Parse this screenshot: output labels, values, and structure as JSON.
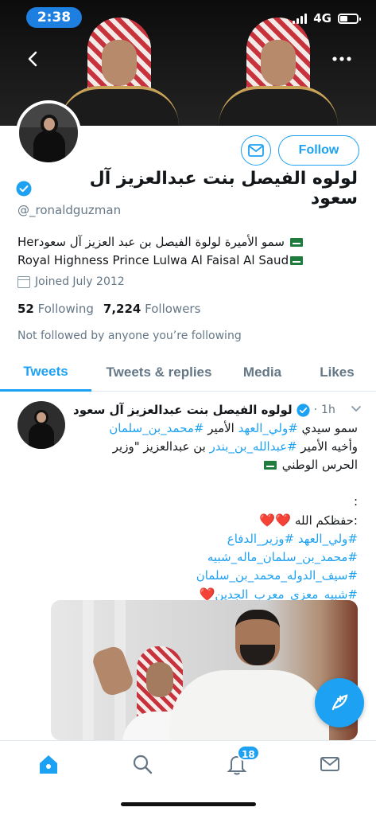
{
  "status_bar": {
    "time": "2:38",
    "network": "4G"
  },
  "header": {
    "back_icon": "chevron-left-icon",
    "more_icon": "more-horizontal-icon",
    "back_glyph": "‹",
    "more_glyph": "•••"
  },
  "profile": {
    "name": "لولوه الفيصل بنت عبدالعزيز آل سعود",
    "handle": "@_ronaldguzman",
    "follow_label": "Follow",
    "bio_line1": "سمو الأميرة لولوة الفيصل بن عبد العزيز آل سعودHer",
    "bio_line2": "Royal Highness Prince Lulwa Al Faisal Al Saud",
    "joined": "Joined July 2012",
    "following_count": "52",
    "following_label": "Following",
    "followers_count": "7,224",
    "followers_label": "Followers",
    "not_followed": "Not followed by anyone you’re following"
  },
  "tabs": [
    {
      "label": "Tweets",
      "active": true
    },
    {
      "label": "Tweets & replies",
      "active": false
    },
    {
      "label": "Media",
      "active": false
    },
    {
      "label": "Likes",
      "active": false
    }
  ],
  "tweet": {
    "author": "لولوه الفيصل بنت عبدالعزيز آل سعود",
    "time": "1h",
    "separator": "·",
    "text_1a": "سمو سيدي ",
    "tag_1": "#ولي_العهد",
    "text_1b": " الأمير ",
    "tag_2": "#محمد_بن_سلمان",
    "text_2a": "وأخيه الأمير ",
    "tag_3": "#عبدالله_بن_بندر",
    "text_2b": " بن عبدالعزيز \"وزير",
    "text_3": "الحرس الوطني",
    "colon_1": ":",
    "text_4a": ":حفظكم الله ",
    "tag_4": "#ولي_العهد #وزير_الدفاع",
    "tag_5": "#محمد_بن_سلمان_ماله_شبيه",
    "tag_6": "#سيف_الدوله_محمد_بن_سلمان",
    "tag_7": "#شبيه_معزي_معرب_الجدين",
    "heart_glyph": "❤️"
  },
  "bottom_nav": {
    "notification_count": "18",
    "icons": [
      "home-icon",
      "search-icon",
      "bell-icon",
      "mail-icon"
    ]
  },
  "colors": {
    "accent": "#1da1f2",
    "text": "#14171a",
    "muted": "#657786",
    "heart": "#e0245e"
  }
}
